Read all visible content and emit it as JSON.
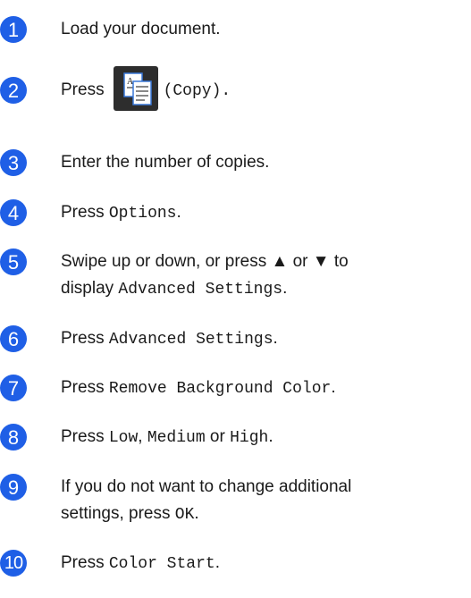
{
  "steps": [
    {
      "number": "1",
      "text": "Load your document."
    },
    {
      "number": "2",
      "prefix": "Press",
      "icon": "copy-icon",
      "label": "(Copy)."
    },
    {
      "number": "3",
      "text": "Enter the number of copies."
    },
    {
      "number": "4",
      "prefix": "Press ",
      "code": "Options",
      "suffix": "."
    },
    {
      "number": "5",
      "line1": "Swipe up or down, or press ▲ or ▼ to",
      "line2_prefix": "display ",
      "code": "Advanced Settings",
      "suffix": "."
    },
    {
      "number": "6",
      "prefix": "Press ",
      "code": "Advanced Settings",
      "suffix": "."
    },
    {
      "number": "7",
      "prefix": "Press ",
      "code": "Remove Background Color",
      "suffix": "."
    },
    {
      "number": "8",
      "prefix": "Press ",
      "code1": "Low",
      "sep1": ", ",
      "code2": "Medium",
      "sep2": " or ",
      "code3": "High",
      "suffix": "."
    },
    {
      "number": "9",
      "line1": "If you do not want to change additional",
      "line2_prefix": "settings, press ",
      "code": "OK",
      "suffix": "."
    },
    {
      "number": "10",
      "prefix": "Press ",
      "code": "Color Start",
      "suffix": "."
    }
  ],
  "colors": {
    "step_badge": "#1f5fe6",
    "icon_bg": "#2d2d2d"
  }
}
